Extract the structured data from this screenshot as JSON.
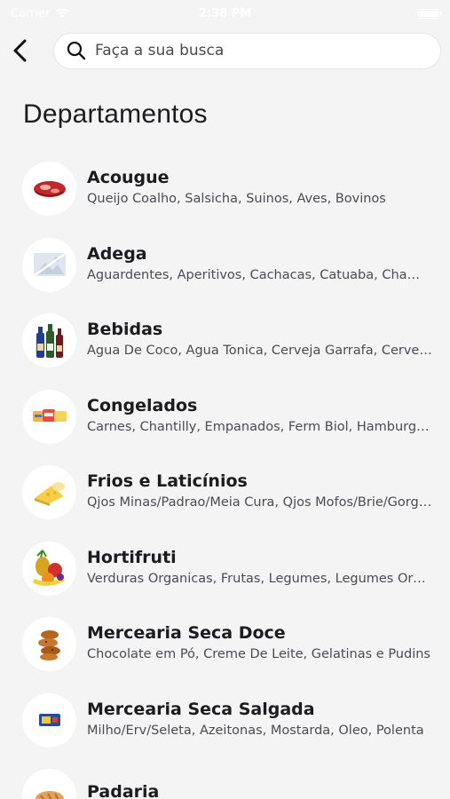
{
  "status_bar": {
    "carrier": "Carrier",
    "time": "2:38 PM"
  },
  "search": {
    "placeholder": "Faça a sua busca"
  },
  "page_title": "Departamentos",
  "departments": [
    {
      "name": "Acougue",
      "subtitle": "Queijo Coalho, Salsicha, Suinos, Aves, Bovinos",
      "icon": "meat-icon"
    },
    {
      "name": "Adega",
      "subtitle": "Aguardentes, Aperitivos, Cachacas, Catuaba, Champanhe",
      "icon": "image-placeholder-icon"
    },
    {
      "name": "Bebidas",
      "subtitle": "Agua De Coco, Agua Tonica, Cerveja Garrafa, Cerveja Lata",
      "icon": "bottles-icon"
    },
    {
      "name": "Congelados",
      "subtitle": "Carnes, Chantilly, Empanados, Ferm Biol, Hamburguer",
      "icon": "frozen-food-icon"
    },
    {
      "name": "Frios e Laticínios",
      "subtitle": "Qjos Minas/Padrao/Meia Cura, Qjos Mofos/Brie/Gorgonzola",
      "icon": "cheese-icon"
    },
    {
      "name": "Hortifruti",
      "subtitle": "Verduras Organicas, Frutas, Legumes, Legumes Organicos",
      "icon": "fruits-icon"
    },
    {
      "name": "Mercearia Seca Doce",
      "subtitle": "Chocolate em Pó, Creme De Leite, Gelatinas e Pudins",
      "icon": "cookies-icon"
    },
    {
      "name": "Mercearia Seca Salgada",
      "subtitle": "Milho/Erv/Seleta, Azeitonas, Mostarda, Oleo, Polenta",
      "icon": "canned-food-icon"
    },
    {
      "name": "Padaria",
      "subtitle": "",
      "icon": "bread-icon"
    }
  ],
  "colors": {
    "background": "#f4f4f5",
    "card": "#ffffff",
    "text": "#1c1c1e",
    "subtext": "#4b4b50"
  }
}
